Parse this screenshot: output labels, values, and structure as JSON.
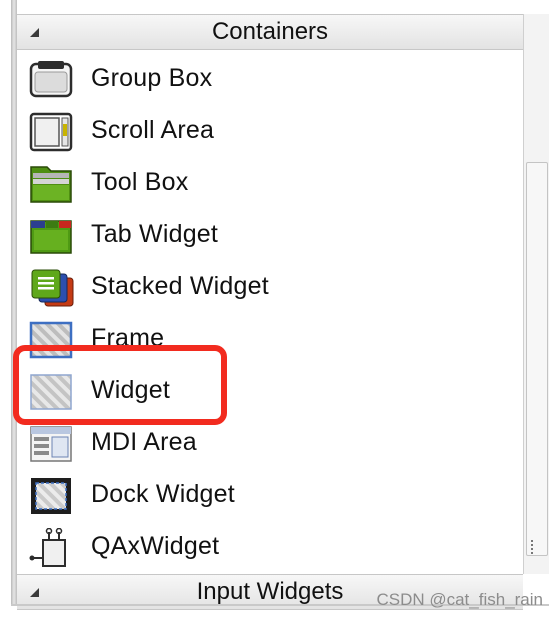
{
  "widget_box": {
    "category_open": {
      "title": "Containers",
      "expanded": true
    },
    "category_next": {
      "title": "Input Widgets",
      "expanded": true
    },
    "items": [
      {
        "label": "Group Box",
        "icon": "group-box-icon"
      },
      {
        "label": "Scroll Area",
        "icon": "scroll-area-icon"
      },
      {
        "label": "Tool Box",
        "icon": "tool-box-icon"
      },
      {
        "label": "Tab Widget",
        "icon": "tab-widget-icon"
      },
      {
        "label": "Stacked Widget",
        "icon": "stacked-widget-icon"
      },
      {
        "label": "Frame",
        "icon": "frame-icon"
      },
      {
        "label": "Widget",
        "icon": "widget-icon",
        "highlighted": true
      },
      {
        "label": "MDI Area",
        "icon": "mdi-area-icon"
      },
      {
        "label": "Dock Widget",
        "icon": "dock-widget-icon"
      },
      {
        "label": "QAxWidget",
        "icon": "qaxwidget-icon"
      }
    ]
  },
  "colors": {
    "highlight": "#f22b1f",
    "icon_green": "#5aa318",
    "icon_blue": "#3d6fc2"
  },
  "watermark": "CSDN @cat_fish_rain"
}
